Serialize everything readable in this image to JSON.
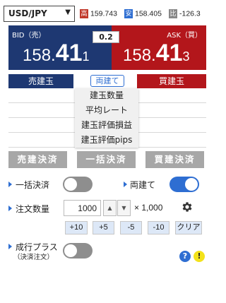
{
  "currency_pair": "USD/JPY",
  "stats": {
    "high_tag": "高",
    "high": "159.743",
    "low_tag": "安",
    "low": "158.405",
    "ratio_tag": "比",
    "change": "-126.3"
  },
  "bid": {
    "label": "BID（売）",
    "prefix": "158.",
    "main": "41",
    "pip": "1"
  },
  "ask": {
    "label": "ASK（買）",
    "prefix": "158.",
    "main": "41",
    "pip": "3"
  },
  "spread": "0.2",
  "position_tabs": {
    "sell": "売建玉",
    "both": "両建て",
    "buy": "買建玉"
  },
  "dropdown_items": [
    "建玉数量",
    "平均レート",
    "建玉評価損益",
    "建玉評価pips"
  ],
  "settle_buttons": {
    "sell": "売建決済",
    "bulk": "一括決済",
    "buy": "買建決済"
  },
  "options": {
    "bulk_settle_label": "一括決済",
    "bulk_settle_on": false,
    "hedge_label": "両建て",
    "hedge_on": true,
    "order_qty_label": "注文数量",
    "order_qty_value": "1000",
    "multiplier": "× 1,000",
    "market_plus_label": "成行プラス",
    "market_plus_sub": "（決済注文）",
    "market_plus_on": false
  },
  "quick_buttons": [
    "+10",
    "+5",
    "-5",
    "-10",
    "クリア"
  ],
  "icons": {
    "help": "?",
    "warn": "!"
  },
  "colors": {
    "bid": "#1e3872",
    "ask": "#b3161b",
    "accent": "#2e6ed2"
  }
}
